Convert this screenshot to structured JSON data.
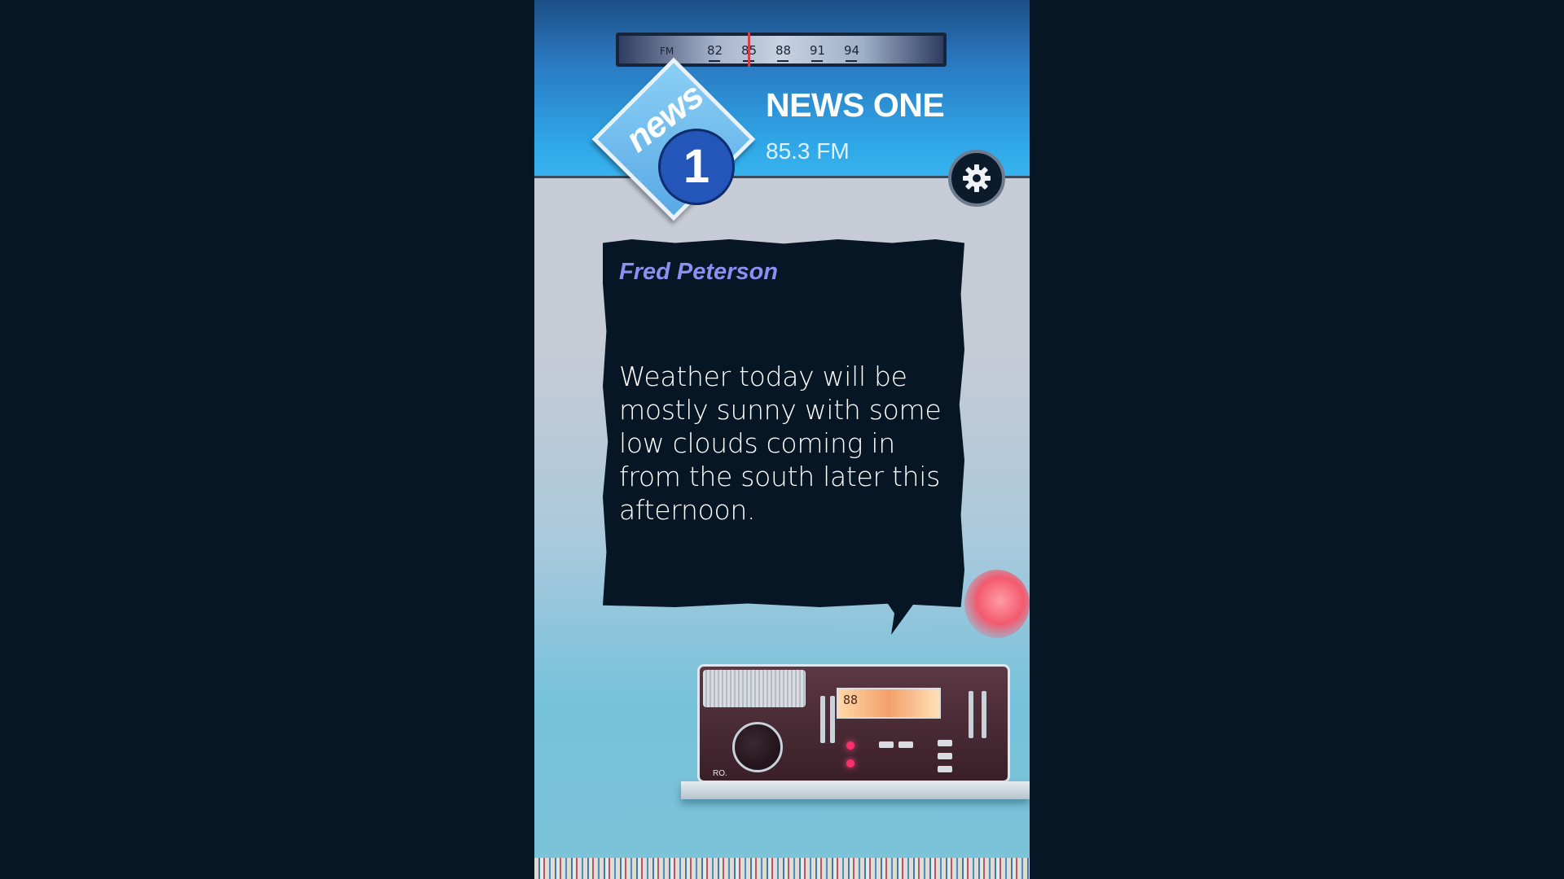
{
  "tuner": {
    "band": "FM",
    "marks": [
      "82",
      "85",
      "88",
      "91",
      "94"
    ]
  },
  "station": {
    "logo_word": "news",
    "logo_number": "1",
    "name": "NEWS ONE",
    "frequency": "85.3 FM"
  },
  "dialogue": {
    "speaker": "Fred Peterson",
    "text": "Weather today will be mostly sunny with some low clouds coming in from the south later this afternoon."
  },
  "radio": {
    "brand": "RO.",
    "display": "88"
  },
  "icons": {
    "settings": "gear-icon"
  },
  "colors": {
    "background": "#061624",
    "header_blue": "#2fa5e6",
    "speaker_name": "#8b8ff0",
    "logo_disc": "#2455b8"
  }
}
